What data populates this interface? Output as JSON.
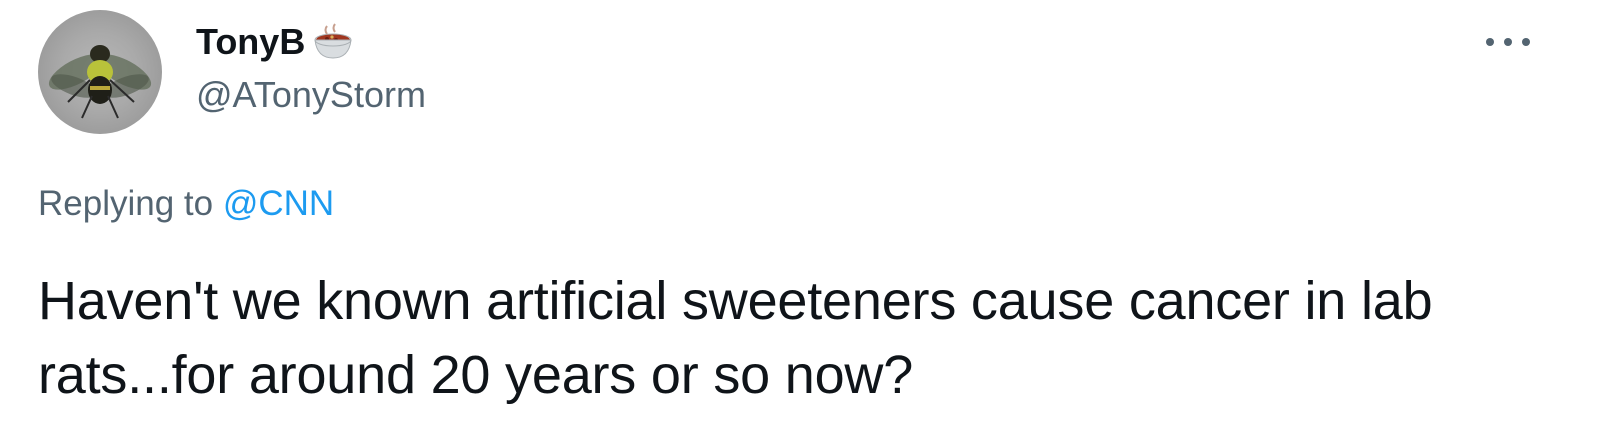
{
  "tweet": {
    "author": {
      "display_name": "TonyB",
      "name_emoji": "bowl-icon",
      "handle": "@ATonyStorm",
      "avatar": "bee-icon"
    },
    "more_icon": "more-horizontal-icon",
    "reply": {
      "prefix": "Replying to",
      "mention": "@CNN"
    },
    "text": "Haven't we known artificial sweeteners cause cancer in lab rats...for around 20 years or so now?"
  },
  "colors": {
    "primary_text": "#0f1419",
    "secondary_text": "#536471",
    "link": "#1d9bf0",
    "background": "#ffffff"
  }
}
